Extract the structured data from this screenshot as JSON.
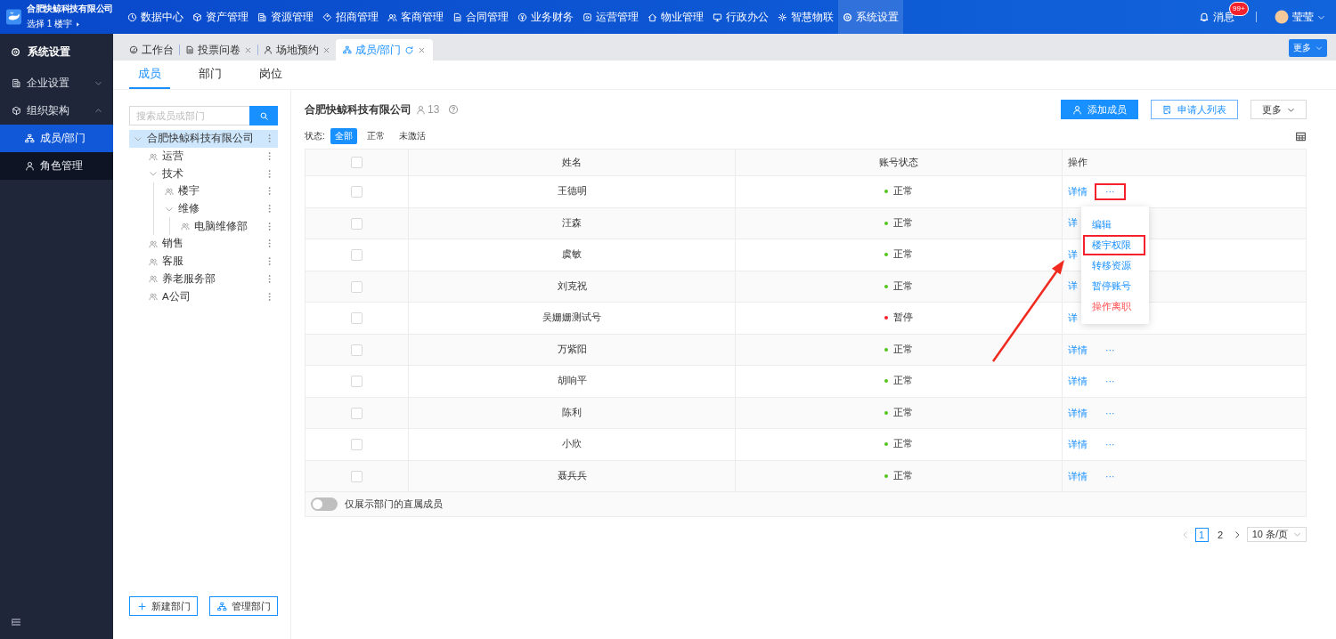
{
  "app": {
    "company": "合肥快鲸科技有限公司",
    "building": "选择 1 楼宇"
  },
  "nav": [
    {
      "label": "数据中心",
      "selected": false
    },
    {
      "label": "资产管理",
      "selected": false
    },
    {
      "label": "资源管理",
      "selected": false
    },
    {
      "label": "招商管理",
      "selected": false
    },
    {
      "label": "客商管理",
      "selected": false
    },
    {
      "label": "合同管理",
      "selected": false
    },
    {
      "label": "业务财务",
      "selected": false
    },
    {
      "label": "运营管理",
      "selected": false
    },
    {
      "label": "物业管理",
      "selected": false
    },
    {
      "label": "行政办公",
      "selected": false
    },
    {
      "label": "智慧物联",
      "selected": false
    },
    {
      "label": "系统设置",
      "selected": true
    }
  ],
  "header_right": {
    "messages": "消息",
    "badge": "99+",
    "user": "莹莹"
  },
  "sidebar": {
    "title": "系统设置",
    "items": [
      {
        "label": "企业设置",
        "expanded": false
      },
      {
        "label": "组织架构",
        "expanded": true,
        "children": [
          {
            "label": "成员/部门",
            "selected": true
          },
          {
            "label": "角色管理",
            "selected": false
          }
        ]
      }
    ]
  },
  "tabs": [
    {
      "label": "工作台",
      "selected": false,
      "closable": false
    },
    {
      "label": "投票问卷",
      "selected": false,
      "closable": true
    },
    {
      "label": "场地预约",
      "selected": false,
      "closable": true
    },
    {
      "label": "成员/部门",
      "selected": true,
      "closable": true
    }
  ],
  "tabs_more": "更多",
  "subtabs": [
    {
      "label": "成员",
      "selected": true
    },
    {
      "label": "部门",
      "selected": false
    },
    {
      "label": "岗位",
      "selected": false
    }
  ],
  "search": {
    "placeholder": "搜索成员或部门"
  },
  "tree": [
    {
      "label": "合肥快鲸科技有限公司",
      "selected": true,
      "expanded": true,
      "children": [
        {
          "label": "运营",
          "selected": false
        },
        {
          "label": "技术",
          "selected": false,
          "expanded": true,
          "children": [
            {
              "label": "楼宇",
              "selected": false
            },
            {
              "label": "维修",
              "selected": false,
              "expanded": true,
              "children": [
                {
                  "label": "电脑维修部",
                  "selected": false
                }
              ]
            }
          ]
        },
        {
          "label": "销售",
          "selected": false
        },
        {
          "label": "客服",
          "selected": false
        },
        {
          "label": "养老服务部",
          "selected": false
        },
        {
          "label": "A公司",
          "selected": false
        }
      ]
    }
  ],
  "tree_buttons": [
    "新建部门",
    "管理部门"
  ],
  "org": {
    "name": "合肥快鲸科技有限公司",
    "count": "13"
  },
  "actions": [
    {
      "label": "添加成员",
      "kind": "primary"
    },
    {
      "label": "申请人列表",
      "kind": "outline"
    },
    {
      "label": "更多",
      "kind": "dropdown"
    }
  ],
  "status_filter": {
    "label": "状态:",
    "options": [
      {
        "label": "全部",
        "selected": true
      },
      {
        "label": "正常",
        "selected": false
      },
      {
        "label": "未激活",
        "selected": false
      }
    ]
  },
  "table": {
    "all_checked": false,
    "columns": [
      "姓名",
      "账号状态",
      "操作"
    ],
    "rows": [
      {
        "checked": false,
        "name": "王德明",
        "status": "正常",
        "color": "#52c41a",
        "actions": [
          "详情",
          "···"
        ],
        "marked": true
      },
      {
        "checked": false,
        "name": "汪森",
        "status": "正常",
        "color": "#52c41a",
        "actions": [
          "详"
        ],
        "marked": false
      },
      {
        "checked": false,
        "name": "虞敏",
        "status": "正常",
        "color": "#52c41a",
        "actions": [
          "详"
        ],
        "marked": false
      },
      {
        "checked": false,
        "name": "刘克祝",
        "status": "正常",
        "color": "#52c41a",
        "actions": [
          "详"
        ],
        "marked": false
      },
      {
        "checked": false,
        "name": "吴姗姗测试号",
        "status": "暂停",
        "color": "#f5222d",
        "actions": [
          "详"
        ],
        "marked": false
      },
      {
        "checked": false,
        "name": "万紫阳",
        "status": "正常",
        "color": "#52c41a",
        "actions": [
          "详情",
          "···"
        ],
        "marked": false
      },
      {
        "checked": false,
        "name": "胡响平",
        "status": "正常",
        "color": "#52c41a",
        "actions": [
          "详情",
          "···"
        ],
        "marked": false
      },
      {
        "checked": false,
        "name": "陈利",
        "status": "正常",
        "color": "#52c41a",
        "actions": [
          "详情",
          "···"
        ],
        "marked": false
      },
      {
        "checked": false,
        "name": "小欣",
        "status": "正常",
        "color": "#52c41a",
        "actions": [
          "详情",
          "···"
        ],
        "marked": false
      },
      {
        "checked": false,
        "name": "聂兵兵",
        "status": "正常",
        "color": "#52c41a",
        "actions": [
          "详情",
          "···"
        ],
        "marked": false
      }
    ]
  },
  "direct_only": {
    "label": "仅展示部门的直属成员",
    "on": false
  },
  "pagination": {
    "pages": [
      {
        "label": "1",
        "selected": true
      },
      {
        "label": "2",
        "selected": false
      }
    ],
    "page_size": "10 条/页"
  },
  "menu": {
    "items": [
      {
        "label": "编辑",
        "kind": "normal",
        "marked": false
      },
      {
        "label": "楼宇权限",
        "kind": "normal",
        "marked": true
      },
      {
        "label": "转移资源",
        "kind": "normal",
        "marked": false
      },
      {
        "label": "暂停账号",
        "kind": "normal",
        "marked": false
      },
      {
        "label": "操作离职",
        "kind": "danger",
        "marked": false
      }
    ]
  }
}
